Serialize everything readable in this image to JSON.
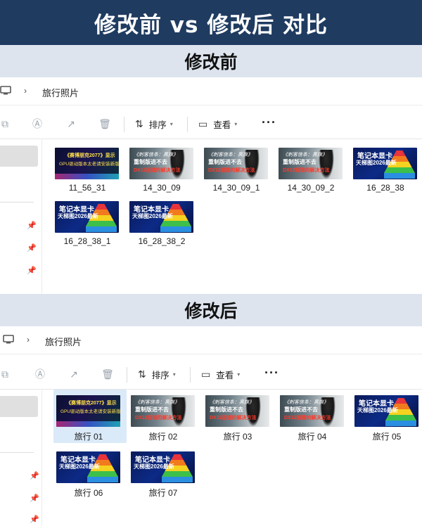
{
  "banner": {
    "title": "修改前 vs 修改后 对比"
  },
  "before": {
    "section_title": "修改前",
    "breadcrumb": "旅行照片",
    "toolbar": {
      "sort_label": "排序",
      "view_label": "查看",
      "more": "···"
    },
    "files": [
      "11_56_31",
      "14_30_09",
      "14_30_09_1",
      "14_30_09_2",
      "16_28_38",
      "16_28_38_1",
      "16_28_38_2"
    ]
  },
  "after": {
    "section_title": "修改后",
    "breadcrumb": "旅行照片",
    "toolbar": {
      "sort_label": "排序",
      "view_label": "查看",
      "more": "···"
    },
    "files": [
      "旅行 01",
      "旅行 02",
      "旅行 03",
      "旅行 04",
      "旅行 05",
      "旅行 06",
      "旅行 07"
    ],
    "selected_index": 0
  },
  "thumbnails": {
    "cyber": {
      "line1": "《赛博朋克2077》显示",
      "line2": "GPU驱动版本太老请安装新版本"
    },
    "ac": {
      "line1": "《刺客信条：黑旗》",
      "line2": "重制版进不去",
      "line3": "DX12报错的解决方法"
    },
    "pyr": {
      "line1": "笔记本显卡",
      "line2": "天梯图2026最新"
    }
  },
  "colors": {
    "banner": "#1f3b60",
    "section": "#dde4ee",
    "selection": "#dbeaf8"
  }
}
